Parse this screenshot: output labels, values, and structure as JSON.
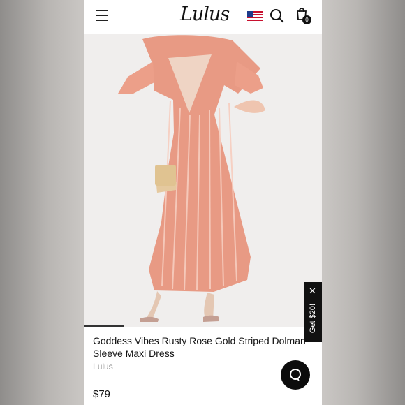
{
  "header": {
    "logo": "Lulus",
    "cart_count": "0",
    "icons": [
      "hamburger-menu-icon",
      "us-flag-icon",
      "search-icon",
      "shopping-bag-icon"
    ]
  },
  "product": {
    "title": "Goddess Vibes Rusty Rose Gold Striped Dolman Sleeve Maxi Dress",
    "brand": "Lulus",
    "price": "$79",
    "image_colors": {
      "dress": "#e89a84",
      "background": "#f0eeed"
    }
  },
  "promo": {
    "label": "Get $20!",
    "close": "✕"
  },
  "chat": {
    "icon": "chat-icon"
  }
}
